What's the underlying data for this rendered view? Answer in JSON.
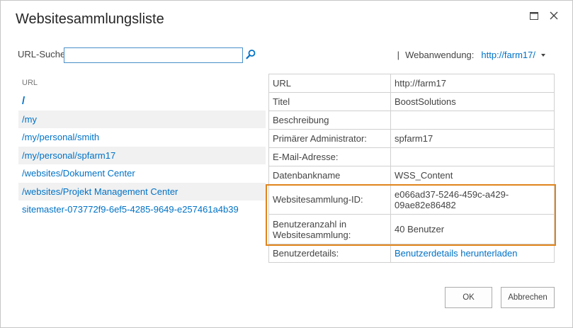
{
  "dialog": {
    "title": "Websitesammlungsliste",
    "maximize_icon": "maximize-icon",
    "close_icon": "close-icon"
  },
  "search": {
    "label": "URL-Suche",
    "value": "",
    "placeholder": "",
    "icon": "search-icon"
  },
  "web_application": {
    "separator": "|",
    "label": "Webanwendung:",
    "value": "http://farm17/",
    "icon": "chevron-down-icon"
  },
  "url_list": {
    "header": "URL",
    "items": [
      "/",
      "/my",
      "/my/personal/smith",
      "/my/personal/spfarm17",
      "/websites/Dokument Center",
      "/websites/Projekt Management Center",
      "sitemaster-073772f9-6ef5-4285-9649-e257461a4b39"
    ]
  },
  "properties": {
    "rows": [
      {
        "key": "URL",
        "value": "http://farm17"
      },
      {
        "key": "Titel",
        "value": "BoostSolutions"
      },
      {
        "key": "Beschreibung",
        "value": ""
      },
      {
        "key": "Primärer Administrator:",
        "value": "spfarm17"
      },
      {
        "key": "E-Mail-Adresse:",
        "value": ""
      },
      {
        "key": "Datenbankname",
        "value": "WSS_Content"
      },
      {
        "key": "Websitesammlung-ID:",
        "value": "e066ad37-5246-459c-a429-09ae82e86482"
      },
      {
        "key": "Benutzeranzahl in Websitesammlung:",
        "value": "40 Benutzer"
      },
      {
        "key": "Benutzerdetails:",
        "value": "Benutzerdetails herunterladen"
      }
    ]
  },
  "buttons": {
    "ok": "OK",
    "cancel": "Abbrechen"
  },
  "colors": {
    "link": "#0072c6",
    "highlight": "#e0841c",
    "input_border": "#4a90c8"
  }
}
